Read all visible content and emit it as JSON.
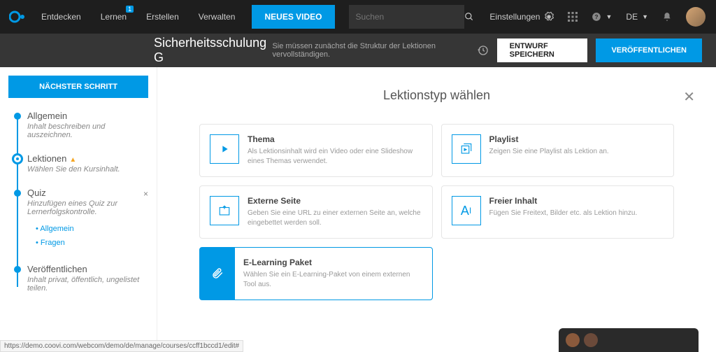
{
  "nav": {
    "discover": "Entdecken",
    "learn": "Lernen",
    "learn_badge": "1",
    "create": "Erstellen",
    "manage": "Verwalten",
    "new_video": "NEUES VIDEO",
    "search_placeholder": "Suchen",
    "settings": "Einstellungen",
    "lang": "DE"
  },
  "subbar": {
    "title": "Sicherheitsschulung G",
    "msg": "Sie müssen zunächst die Struktur der Lektionen vervollständigen.",
    "save_draft": "ENTWURF SPEICHERN",
    "publish": "VERÖFFENTLICHEN"
  },
  "sidebar": {
    "next": "NÄCHSTER SCHRITT",
    "steps": [
      {
        "title": "Allgemein",
        "desc": "Inhalt beschreiben und auszeichnen."
      },
      {
        "title": "Lektionen",
        "desc": "Wählen Sie den Kursinhalt."
      },
      {
        "title": "Quiz",
        "desc": "Hinzufügen eines Quiz zur Lernerfolgskontrolle."
      },
      {
        "title": "Veröffentlichen",
        "desc": "Inhalt privat, öffentlich, ungelistet teilen."
      }
    ],
    "quiz_sub": [
      "Allgemein",
      "Fragen"
    ]
  },
  "modal": {
    "title": "Lektionstyp wählen",
    "cards": {
      "thema": {
        "title": "Thema",
        "desc": "Als Lektionsinhalt wird ein Video oder eine Slideshow eines Themas verwendet."
      },
      "playlist": {
        "title": "Playlist",
        "desc": "Zeigen Sie eine Playlist als Lektion an."
      },
      "extern": {
        "title": "Externe Seite",
        "desc": "Geben Sie eine URL zu einer externen Seite an, welche eingebettet werden soll."
      },
      "freier": {
        "title": "Freier Inhalt",
        "desc": "Fügen Sie Freitext, Bilder etc. als Lektion hinzu."
      },
      "elearn": {
        "title": "E-Learning Paket",
        "desc": "Wählen Sie ein E-Learning-Paket von einem externen Tool aus."
      }
    }
  },
  "status_url": "https://demo.coovi.com/webcom/demo/de/manage/courses/ccff1bccd1/edit#"
}
